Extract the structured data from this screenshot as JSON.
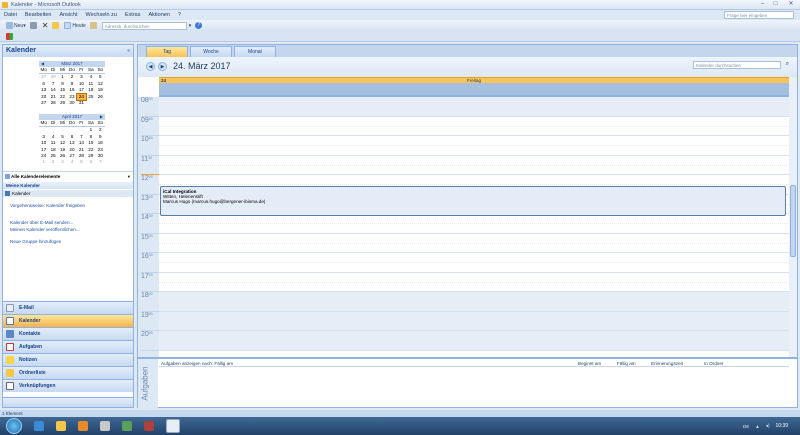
{
  "window": {
    "title": "Kalender - Microsoft Outlook",
    "btn_min": "–",
    "btn_max": "□",
    "btn_close": "✕"
  },
  "menu": [
    "Datei",
    "Bearbeiten",
    "Ansicht",
    "Wechseln zu",
    "Extras",
    "Aktionen",
    "?"
  ],
  "help_placeholder": "Frage hier eingeben",
  "toolbar": {
    "new_label": "Neu",
    "today_label": "Heute",
    "address_placeholder": "Adressb. durchsuchen",
    "help_icon": "?"
  },
  "leftpane": {
    "title": "Kalender",
    "collapse": "«",
    "march": {
      "title": "März 2017",
      "headers": [
        "Mo",
        "Di",
        "Mi",
        "Do",
        "Fr",
        "Sa",
        "So"
      ],
      "days": [
        "27",
        "28",
        "1",
        "2",
        "3",
        "4",
        "5",
        "6",
        "7",
        "8",
        "9",
        "10",
        "11",
        "12",
        "13",
        "14",
        "15",
        "16",
        "17",
        "18",
        "19",
        "20",
        "21",
        "22",
        "23",
        "24",
        "25",
        "26",
        "27",
        "28",
        "29",
        "30",
        "31",
        "",
        ""
      ]
    },
    "april": {
      "title": "April 2017",
      "headers": [
        "Mo",
        "Di",
        "Mi",
        "Do",
        "Fr",
        "Sa",
        "So"
      ],
      "days": [
        "",
        "",
        "",
        "",
        "",
        "1",
        "2",
        "3",
        "4",
        "5",
        "6",
        "7",
        "8",
        "9",
        "10",
        "11",
        "12",
        "13",
        "14",
        "15",
        "16",
        "17",
        "18",
        "19",
        "20",
        "21",
        "22",
        "23",
        "24",
        "25",
        "26",
        "27",
        "28",
        "29",
        "30",
        "1",
        "2",
        "3",
        "4",
        "5",
        "6",
        "7"
      ]
    },
    "filter_label": "Alle Kalenderelemente",
    "my_calendars": "Meine Kalender",
    "calendar_item": "Kalender",
    "links": [
      "Vorgehensweise: Kalender freigeben",
      "Kalender über E-Mail senden...",
      "Meinen Kalender veröffentlichen...",
      "Neue Gruppe hinzufügen"
    ],
    "nav": [
      "E-Mail",
      "Kalender",
      "Kontakte",
      "Aufgaben",
      "Notizen",
      "Ordnerliste",
      "Verknüpfungen"
    ]
  },
  "calendar": {
    "tabs": [
      "Tag",
      "Woche",
      "Monat"
    ],
    "date_title": "24. März 2017",
    "search_placeholder": "Kalender durchsuchen",
    "day_number": "24",
    "day_name": "Freitag",
    "hours": [
      "08",
      "09",
      "10",
      "11",
      "12",
      "13",
      "14",
      "15",
      "16",
      "17",
      "18",
      "19",
      "20"
    ],
    "minutes": "00",
    "appointment": {
      "subject": "iCal Integration",
      "location": "Witten, Helenenstift",
      "organizer": "Marcus Hugo (marcus.hugo@bergener-ibisma.de)"
    },
    "tasks_label": "Aufgaben",
    "task_headers": {
      "show": "Aufgaben anzeigen nach: Fällig am",
      "start": "Beginnt am",
      "due": "Fällig am",
      "reminder": "Erinnerungszeit",
      "folder": "In Ordner"
    }
  },
  "status": "1 Element",
  "taskbar": {
    "lang": "DE",
    "time": "10:39"
  },
  "colors": {
    "accent": "#f8b24c",
    "frame": "#8db2e3",
    "header": "#15428b"
  }
}
